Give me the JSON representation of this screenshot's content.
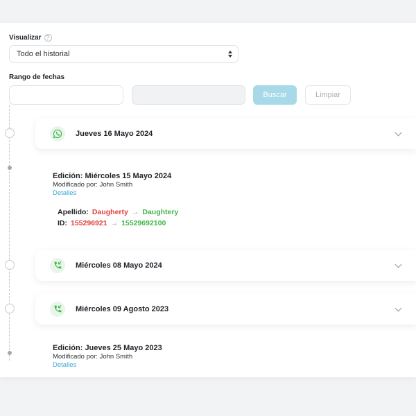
{
  "filters": {
    "visualizar_label": "Visualizar",
    "help_icon": "?",
    "visualizar_value": "Todo el historial",
    "rango_label": "Rango de fechas",
    "date_from_value": "",
    "date_to_value": "",
    "buscar_label": "Buscar",
    "limpiar_label": "Limpiar"
  },
  "timeline": {
    "cards": [
      {
        "title": "Jueves 16 Mayo 2024",
        "icon": "whatsapp-icon"
      },
      {
        "title": "Miércoles 08 Mayo 2024",
        "icon": "phone-incoming-icon"
      },
      {
        "title": "Miércoles 09 Agosto 2023",
        "icon": "phone-incoming-icon"
      }
    ],
    "entries": [
      {
        "title": "Edición: Miércoles 15 Mayo 2024",
        "modified_by": "Modificado por: John Smith",
        "details_link": "Detalles",
        "changes": [
          {
            "field": "Apellido:",
            "old": "Daugherty",
            "arrow": "→",
            "new": "Daughtery"
          },
          {
            "field": "ID:",
            "old": "155296921",
            "arrow": "→",
            "new": "15529692100"
          }
        ]
      },
      {
        "title": "Edición: Jueves 25 Mayo 2023",
        "modified_by": "Modificado por: John Smith",
        "details_link": "Detalles"
      }
    ]
  },
  "colors": {
    "accent_green": "#3fb54a",
    "old_value_red": "#e0413c",
    "link_blue": "#3aa7d6",
    "primary_button": "#a7d9e8"
  }
}
